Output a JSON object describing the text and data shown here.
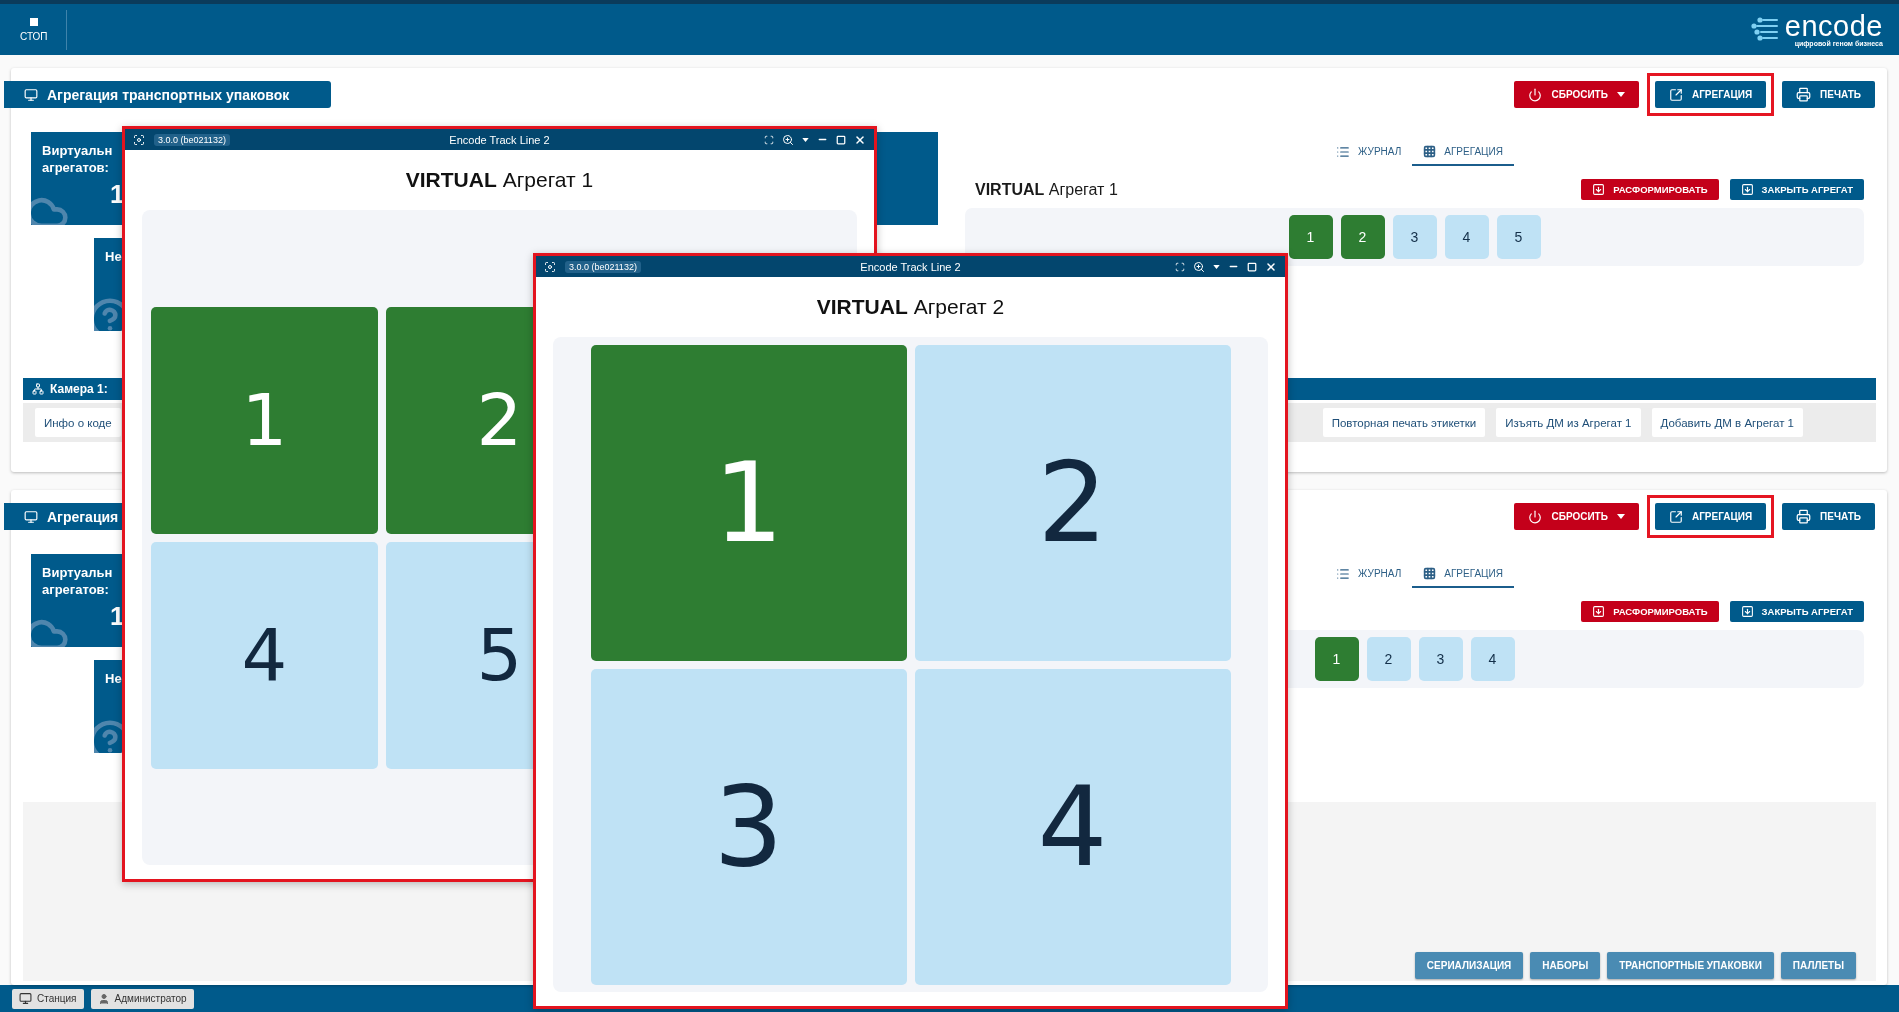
{
  "top_bar": {
    "stop_button": {
      "label": "СТОП"
    },
    "logo": {
      "name": "encode",
      "tagline": "цифровой геном бизнеса"
    }
  },
  "panels": [
    {
      "title": "Агрегация транспортных упаковок",
      "header_buttons": [
        {
          "kind": "reset",
          "label": "СБРОСИТЬ",
          "highlighted": false
        },
        {
          "kind": "aggregation",
          "label": "АГРЕГАЦИЯ",
          "highlighted": true
        },
        {
          "kind": "print",
          "label": "ПЕЧАТЬ",
          "highlighted": false
        }
      ],
      "stat_cards": [
        {
          "lines": [
            "Виртуальн",
            "агрегатов:"
          ],
          "value": "1"
        },
        {
          "lines": [
            "Не"
          ]
        }
      ],
      "tabs": [
        {
          "kind": "journal",
          "label": "ЖУРНАЛ",
          "selected": false
        },
        {
          "kind": "aggregation",
          "label": "АГРЕГАЦИЯ",
          "selected": true
        }
      ],
      "aggregate_title": {
        "prefix": "VIRTUAL",
        "name": "Агрегат 1"
      },
      "actions": [
        {
          "kind": "disband",
          "label": "РАСФОРМИРОВАТЬ"
        },
        {
          "kind": "close",
          "label": "ЗАКРЫТЬ АГРЕГАТ"
        }
      ],
      "slots": [
        {
          "label": "1",
          "filled": true
        },
        {
          "label": "2",
          "filled": true
        },
        {
          "label": "3",
          "filled": false
        },
        {
          "label": "4",
          "filled": false
        },
        {
          "label": "5",
          "filled": false
        }
      ],
      "camera": {
        "label": "Камера 1:",
        "left_buttons": [
          "Инфо о коде"
        ],
        "right_buttons": [
          "Повторная печать этикетки",
          "Изъять ДМ из Агрегат 1",
          "Добавить ДМ в Агрегат 1"
        ]
      }
    },
    {
      "title": "Агрегация",
      "header_buttons": [
        {
          "kind": "reset",
          "label": "СБРОСИТЬ",
          "highlighted": false
        },
        {
          "kind": "aggregation",
          "label": "АГРЕГАЦИЯ",
          "highlighted": true
        },
        {
          "kind": "print",
          "label": "ПЕЧАТЬ",
          "highlighted": false
        }
      ],
      "stat_cards": [
        {
          "lines": [
            "Виртуальн",
            "агрегатов:"
          ],
          "value": "1"
        },
        {
          "lines": [
            "Не"
          ]
        }
      ],
      "tabs": [
        {
          "kind": "journal",
          "label": "ЖУРНАЛ",
          "selected": false
        },
        {
          "kind": "aggregation",
          "label": "АГРЕГАЦИЯ",
          "selected": true
        }
      ],
      "actions": [
        {
          "kind": "disband",
          "label": "РАСФОРМИРОВАТЬ"
        },
        {
          "kind": "close",
          "label": "ЗАКРЫТЬ АГРЕГАТ"
        }
      ],
      "slots": [
        {
          "label": "1",
          "filled": true
        },
        {
          "label": "2",
          "filled": false
        },
        {
          "label": "3",
          "filled": false
        },
        {
          "label": "4",
          "filled": false
        }
      ],
      "footer_buttons": [
        "СЕРИАЛИЗАЦИЯ",
        "НАБОРЫ",
        "ТРАНСПОРТНЫЕ УПАКОВКИ",
        "ПАЛЛЕТЫ"
      ]
    }
  ],
  "windows": [
    {
      "version": "3.0.0 (be021132)",
      "title": "Encode Track Line 2",
      "heading": {
        "prefix": "VIRTUAL",
        "name": "Агрегат 1"
      },
      "tile_rows": [
        [
          {
            "label": "1",
            "filled": true
          },
          {
            "label": "2",
            "filled": true
          }
        ],
        [
          {
            "label": "4",
            "filled": false
          },
          {
            "label": "5",
            "filled": false
          }
        ]
      ]
    },
    {
      "version": "3.0.0 (be021132)",
      "title": "Encode Track Line 2",
      "heading": {
        "prefix": "VIRTUAL",
        "name": "Агрегат 2"
      },
      "tile_rows": [
        [
          {
            "label": "1",
            "filled": true
          },
          {
            "label": "2",
            "filled": false
          }
        ],
        [
          {
            "label": "3",
            "filled": false
          },
          {
            "label": "4",
            "filled": false
          }
        ]
      ]
    }
  ],
  "status_bar": [
    {
      "kind": "station",
      "label": "Станция"
    },
    {
      "kind": "user",
      "label": "Администратор"
    }
  ]
}
